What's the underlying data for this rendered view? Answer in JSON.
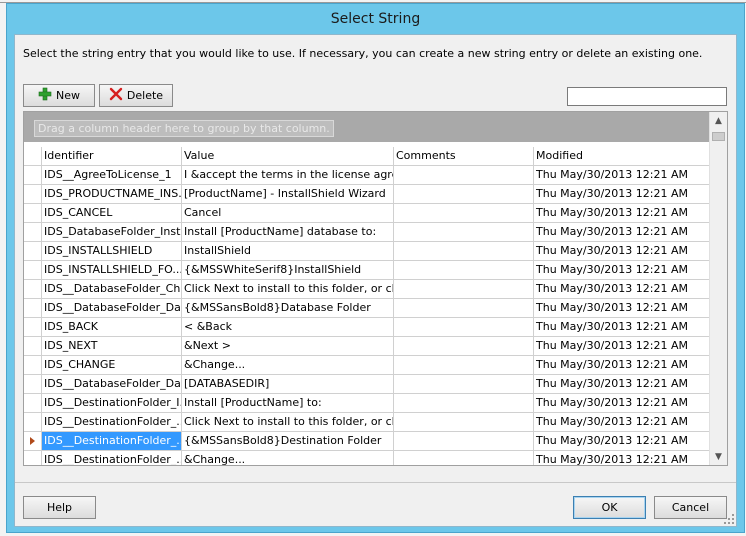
{
  "window": {
    "title": "Select String"
  },
  "instructions": "Select the string entry that you would like to use. If necessary, you can create a new string entry or delete an existing one.",
  "toolbar": {
    "new_label": "New",
    "new_icon": "plus-icon",
    "delete_label": "Delete",
    "delete_icon": "red-x-icon"
  },
  "search": {
    "value": "",
    "placeholder": ""
  },
  "grid": {
    "group_hint": "Drag a column header here to group by that column.",
    "columns": [
      "Identifier",
      "Value",
      "Comments",
      "Modified"
    ],
    "selected_row": 14,
    "rows": [
      {
        "id": "IDS__AgreeToLicense_1",
        "value": "I &accept the terms in the license agree...",
        "comments": "",
        "modified": "Thu May/30/2013 12:21 AM"
      },
      {
        "id": "IDS_PRODUCTNAME_INS...",
        "value": "[ProductName] - InstallShield Wizard",
        "comments": "",
        "modified": "Thu May/30/2013 12:21 AM"
      },
      {
        "id": "IDS_CANCEL",
        "value": "Cancel",
        "comments": "",
        "modified": "Thu May/30/2013 12:21 AM"
      },
      {
        "id": "IDS_DatabaseFolder_Inst...",
        "value": "Install [ProductName] database to:",
        "comments": "",
        "modified": "Thu May/30/2013 12:21 AM"
      },
      {
        "id": "IDS_INSTALLSHIELD",
        "value": "InstallShield",
        "comments": "",
        "modified": "Thu May/30/2013 12:21 AM"
      },
      {
        "id": "IDS_INSTALLSHIELD_FO...",
        "value": "{&MSSWhiteSerif8}InstallShield",
        "comments": "",
        "modified": "Thu May/30/2013 12:21 AM"
      },
      {
        "id": "IDS__DatabaseFolder_Ch...",
        "value": "Click Next to install to this folder, or click...",
        "comments": "",
        "modified": "Thu May/30/2013 12:21 AM"
      },
      {
        "id": "IDS__DatabaseFolder_Da...",
        "value": "{&MSSansBold8}Database Folder",
        "comments": "",
        "modified": "Thu May/30/2013 12:21 AM"
      },
      {
        "id": "IDS_BACK",
        "value": "< &Back",
        "comments": "",
        "modified": "Thu May/30/2013 12:21 AM"
      },
      {
        "id": "IDS_NEXT",
        "value": "&Next >",
        "comments": "",
        "modified": "Thu May/30/2013 12:21 AM"
      },
      {
        "id": "IDS_CHANGE",
        "value": "&Change...",
        "comments": "",
        "modified": "Thu May/30/2013 12:21 AM"
      },
      {
        "id": "IDS__DatabaseFolder_Da...",
        "value": "[DATABASEDIR]",
        "comments": "",
        "modified": "Thu May/30/2013 12:21 AM"
      },
      {
        "id": "IDS__DestinationFolder_I...",
        "value": "Install [ProductName] to:",
        "comments": "",
        "modified": "Thu May/30/2013 12:21 AM"
      },
      {
        "id": "IDS__DestinationFolder_...",
        "value": "Click Next to install to this folder, or click...",
        "comments": "",
        "modified": "Thu May/30/2013 12:21 AM"
      },
      {
        "id": "IDS__DestinationFolder_...",
        "value": "{&MSSansBold8}Destination Folder",
        "comments": "",
        "modified": "Thu May/30/2013 12:21 AM"
      },
      {
        "id": "IDS__DestinationFolder_...",
        "value": "&Change...",
        "comments": "",
        "modified": "Thu May/30/2013 12:21 AM"
      }
    ]
  },
  "footer": {
    "help_label": "Help",
    "ok_label": "OK",
    "cancel_label": "Cancel"
  },
  "colors": {
    "titlebar": "#6cc7ea",
    "selection": "#3399ff",
    "row_indicator": "#b04a1a"
  }
}
